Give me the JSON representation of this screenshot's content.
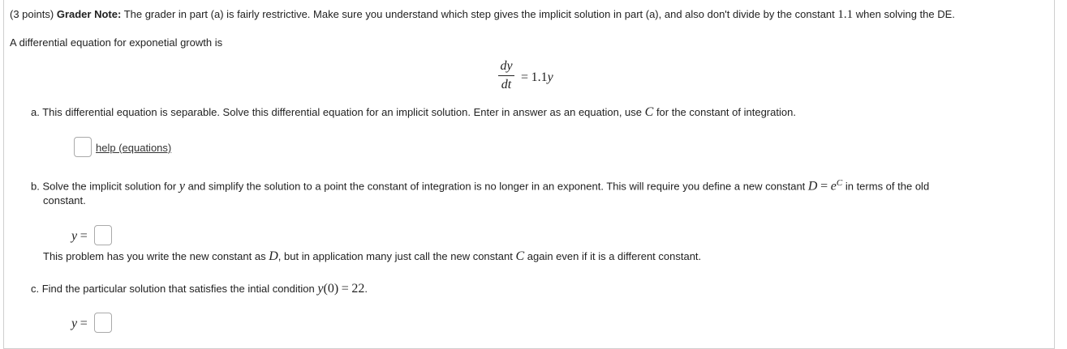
{
  "header": {
    "points": "(3 points)",
    "grader_label": "Grader Note:",
    "grader_note_1": "The grader in part (a) is fairly restrictive. Make sure you understand which step gives the implicit solution in part (a), and also don't divide by the constant",
    "grader_constant": "1.1",
    "grader_note_2": "when solving the DE."
  },
  "intro": "A differential equation for exponetial growth is",
  "equation": {
    "numerator": "dy",
    "denominator": "dt",
    "rhs_equals": "=",
    "rhs_value": "1.1",
    "rhs_var": "y"
  },
  "part_a": {
    "text_1": "a. This differential equation is separable. Solve this differential equation for an implicit solution. Enter in answer as an equation, use",
    "var_C": "C",
    "text_2": "for the constant of integration.",
    "answer_value": "",
    "help_link": "help (equations)"
  },
  "part_b": {
    "text_1": "b. Solve the implicit solution for",
    "var_y": "y",
    "text_2": "and simplify the solution to a point the constant of integration is no longer in an exponent. This will require you define a new constant",
    "var_D": "D",
    "eq": "=",
    "e": "e",
    "sup_C": "C",
    "text_3": "in terms of the old",
    "text_4": "constant.",
    "answer_label_var": "y",
    "answer_label_eq": "=",
    "answer_value": "",
    "note_1": "This problem has you write the new constant as",
    "note_D": "D",
    "note_2": ", but in application many just call the new constant",
    "note_C": "C",
    "note_3": "again even if it is a different constant."
  },
  "part_c": {
    "text_1": "c. Find the particular solution that satisfies the intial condition",
    "cond_y": "y",
    "cond_arg": "(0)",
    "cond_eq": "=",
    "cond_val": "22",
    "cond_end": ".",
    "answer_label_var": "y",
    "answer_label_eq": "=",
    "answer_value": ""
  }
}
